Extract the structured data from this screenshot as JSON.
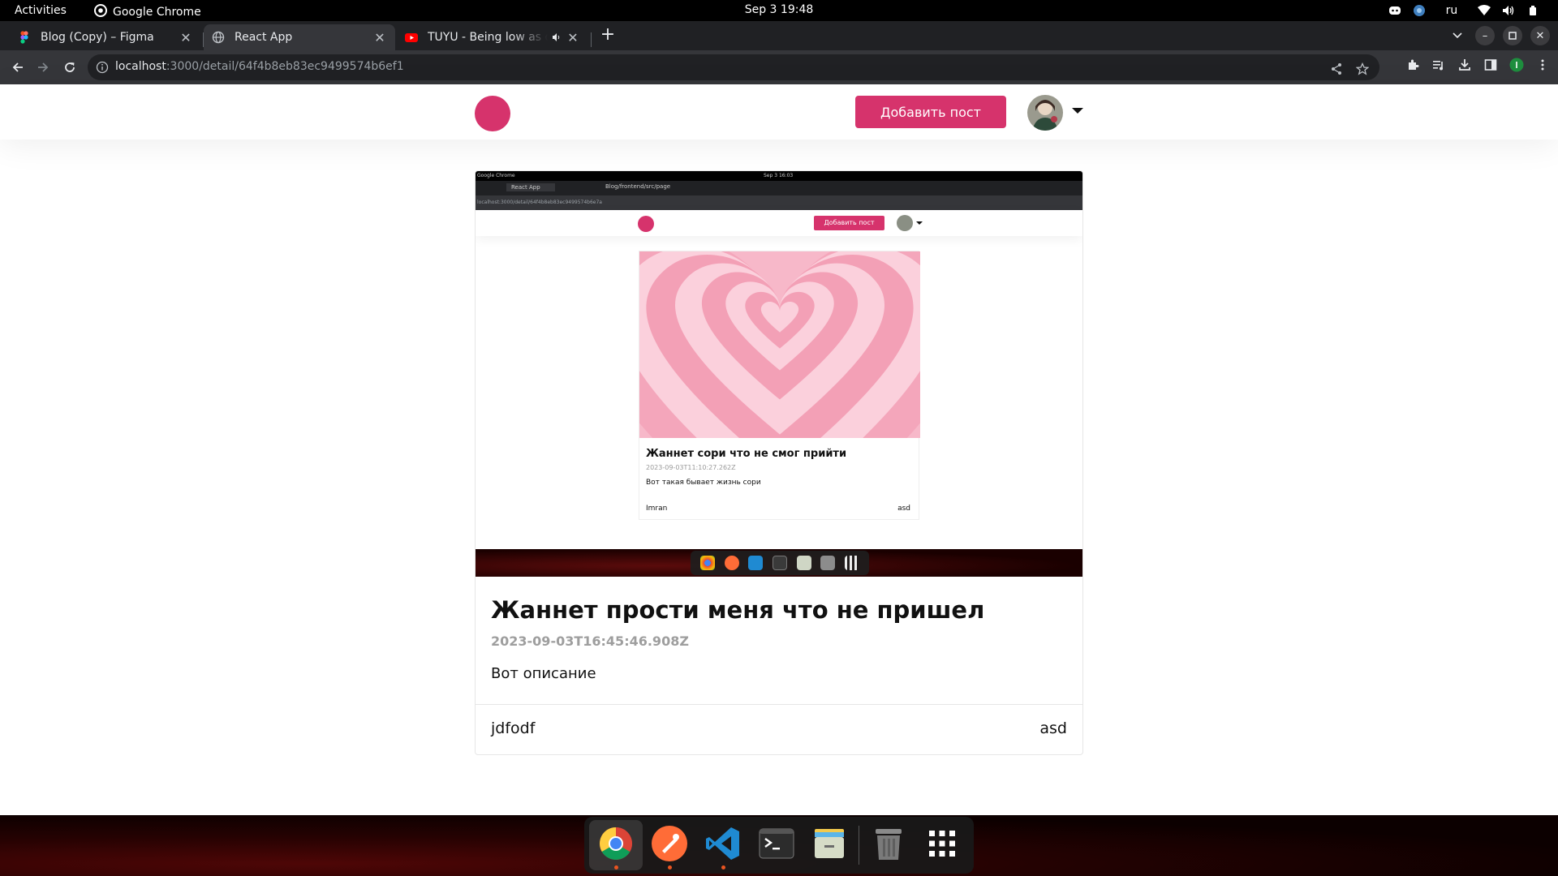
{
  "system": {
    "activities": "Activities",
    "app_name": "Google Chrome",
    "clock": "Sep 3  19:48",
    "language": "ru"
  },
  "browser": {
    "tabs": [
      {
        "title": "Blog (Copy) – Figma",
        "icon": "figma-icon",
        "active": false
      },
      {
        "title": "React App",
        "icon": "globe-icon",
        "active": true
      },
      {
        "title": "TUYU - Being low as dirt",
        "icon": "youtube-icon",
        "active": false
      }
    ],
    "url_host": "localhost",
    "url_path": ":3000/detail/64f4b8eb83ec9499574b6ef1"
  },
  "header": {
    "add_post_label": "Добавить пост"
  },
  "post": {
    "title": "Жаннет прости меня что не пришел",
    "date": "2023-09-03T16:45:46.908Z",
    "description": "Вот описание",
    "author": "jdfodf",
    "tag": "asd",
    "image": {
      "topbar_app": "Google Chrome",
      "topbar_clock": "Sep 3  16:03",
      "tabs": [
        "React App",
        "Blog/frontend/src/page"
      ],
      "url": "localhost:3000/detail/64f4b8eb83ec9499574b6e7a",
      "add_post_label": "Добавить пост",
      "card_title": "Жаннет сори что не смог прийти",
      "card_date": "2023-09-03T11:10:27.262Z",
      "card_desc": "Вот такая бывает жизнь сори",
      "card_author": "Imran",
      "card_tag": "asd"
    }
  },
  "dock": {
    "items": [
      "chrome-icon",
      "postman-icon",
      "vscode-icon",
      "terminal-icon",
      "files-icon",
      "trash-icon",
      "app-grid-icon"
    ]
  },
  "colors": {
    "accent": "#d6336c",
    "chrome_dark": "#202124",
    "chrome_toolbar": "#35363a"
  }
}
